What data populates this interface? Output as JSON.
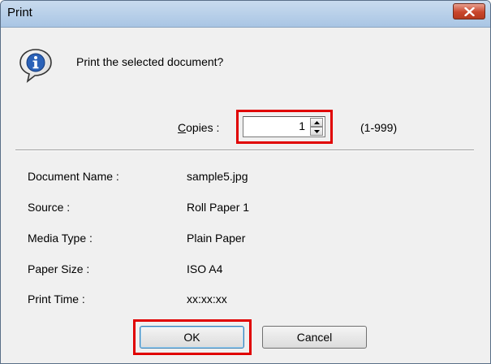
{
  "window": {
    "title": "Print"
  },
  "dialog": {
    "message": "Print the selected document?",
    "copies": {
      "label_accel": "C",
      "label_rest": "opies :",
      "value": "1",
      "range": "(1-999)"
    },
    "details": [
      {
        "label": "Document Name :",
        "value": "sample5.jpg"
      },
      {
        "label": "Source :",
        "value": "Roll Paper 1"
      },
      {
        "label": "Media Type :",
        "value": "Plain Paper"
      },
      {
        "label": "Paper Size :",
        "value": "ISO A4"
      },
      {
        "label": "Print Time :",
        "value": "xx:xx:xx"
      }
    ],
    "buttons": {
      "ok": "OK",
      "cancel": "Cancel"
    }
  },
  "icons": {
    "info": "info-icon",
    "close": "close-icon"
  },
  "colors": {
    "highlight": "#e00000",
    "close_button": "#c9462c"
  }
}
